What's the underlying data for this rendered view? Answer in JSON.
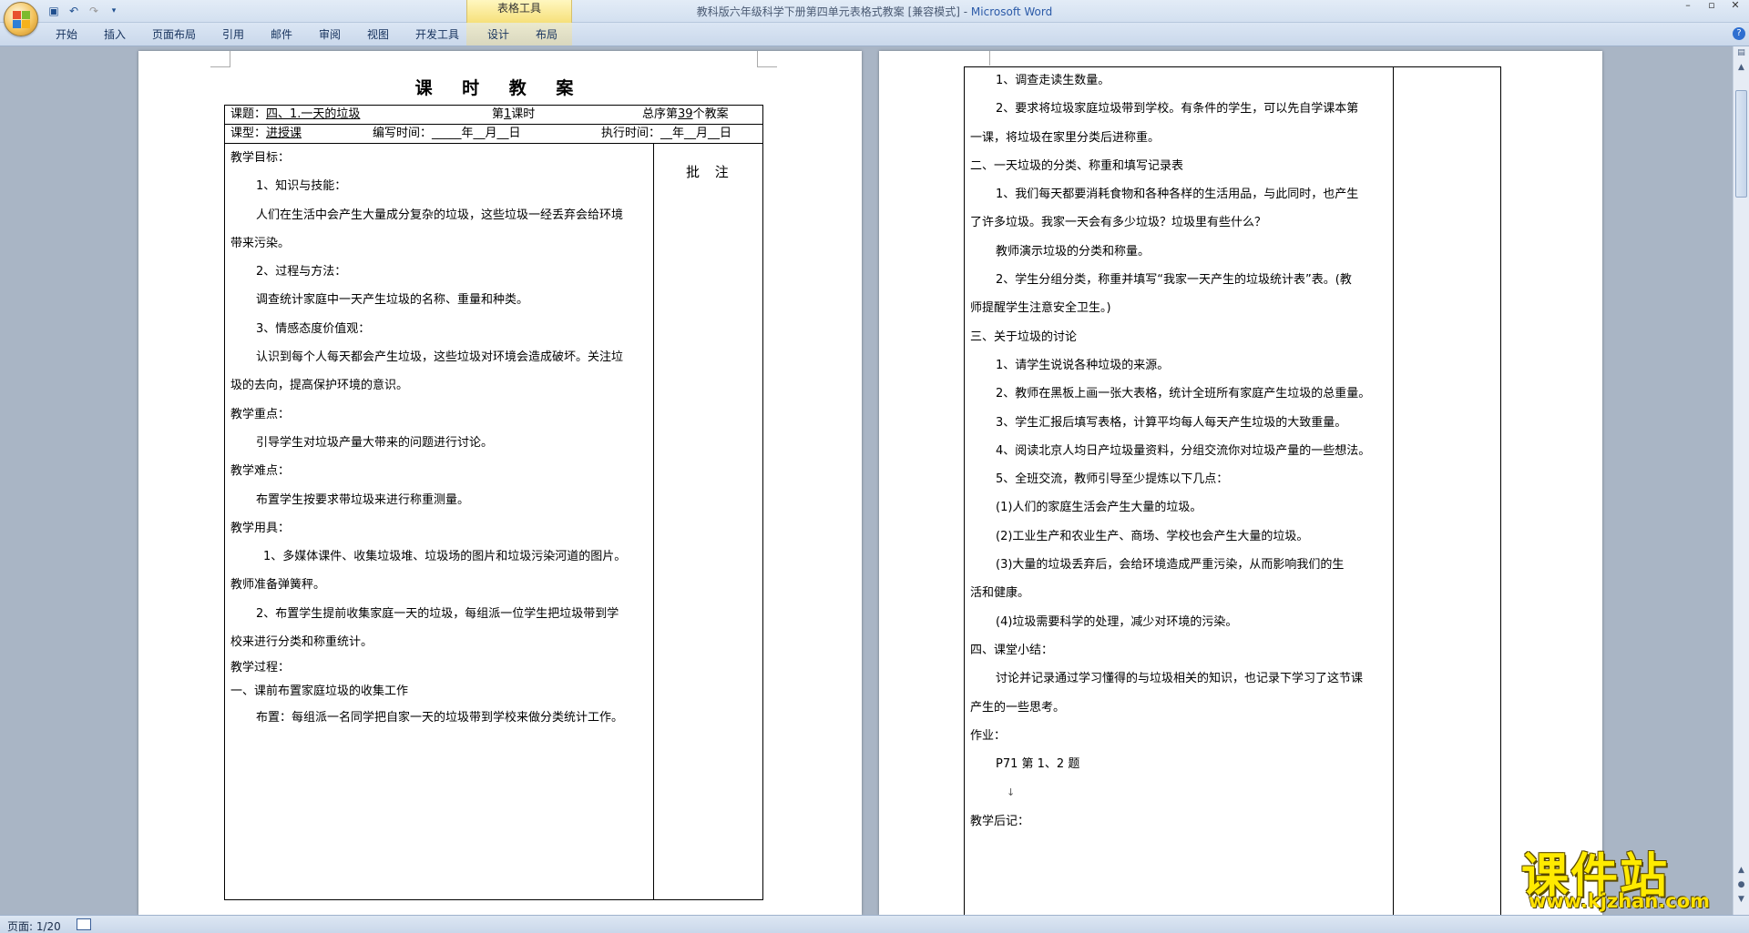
{
  "window": {
    "title": "教科版六年级科学下册第四单元表格式教案 [兼容模式] - ",
    "app_name": "Microsoft Word",
    "context_tab": "表格工具"
  },
  "ribbon_tabs": [
    "开始",
    "插入",
    "页面布局",
    "引用",
    "邮件",
    "审阅",
    "视图",
    "开发工具",
    "设计",
    "布局"
  ],
  "page1": {
    "title": "课 时 教 案",
    "header": {
      "topic_label": "课题：",
      "topic_value": "四、1.一天的垃圾",
      "lesson_prefix": "第",
      "lesson_num": "1",
      "lesson_suffix": "课时",
      "total_prefix": "总序第",
      "total_num": "39",
      "total_suffix": "个教案",
      "type_label": "课型：",
      "type_value": "进授课",
      "write_time": "编写时间：_____年__月__日",
      "exec_time": "执行时间：__年__月__日"
    },
    "annotation_label": "批 注",
    "lines": [
      "教学目标：",
      "1、知识与技能：",
      "人们在生活中会产生大量成分复杂的垃圾，这些垃圾一经丢弃会给环境",
      "带来污染。",
      "",
      "2、过程与方法：",
      "调查统计家庭中一天产生垃圾的名称、重量和种类。",
      "",
      "3、情感态度价值观：",
      "认识到每个人每天都会产生垃圾，这些垃圾对环境会造成破坏。关注垃",
      "圾的去向，提高保护环境的意识。",
      "",
      "教学重点：",
      "引导学生对垃圾产量大带来的问题进行讨论。",
      "",
      "教学难点：",
      "布置学生按要求带垃圾来进行称重测量。",
      "",
      "教学用具：",
      "1、多媒体课件、收集垃圾堆、垃圾场的图片和垃圾污染河道的图片。",
      "教师准备弹簧秤。",
      "2、布置学生提前收集家庭一天的垃圾，每组派一位学生把垃圾带到学",
      "校来进行分类和称重统计。",
      "",
      "教学过程：",
      "一、课前布置家庭垃圾的收集工作",
      "布置：每组派一名同学把自家一天的垃圾带到学校来做分类统计工作。"
    ]
  },
  "page2": {
    "lines": [
      "1、调查走读生数量。",
      "2、要求将垃圾家庭垃圾带到学校。有条件的学生，可以先自学课本第",
      "一课，将垃圾在家里分类后进称重。",
      "二、一天垃圾的分类、称重和填写记录表",
      "1、我们每天都要消耗食物和各种各样的生活用品，与此同时，也产生",
      "了许多垃圾。我家一天会有多少垃圾？垃圾里有些什么？",
      "教师演示垃圾的分类和称量。",
      "2、学生分组分类，称重并填写“我家一天产生的垃圾统计表”表。(教",
      "师提醒学生注意安全卫生。)",
      "三、关于垃圾的讨论",
      "1、请学生说说各种垃圾的来源。",
      "2、教师在黑板上画一张大表格，统计全班所有家庭产生垃圾的总重量。",
      "3、学生汇报后填写表格，计算平均每人每天产生垃圾的大致重量。",
      "4、阅读北京人均日产垃圾量资料，分组交流你对垃圾产量的一些想法。",
      "5、全班交流，教师引导至少提炼以下几点：",
      "(1)人们的家庭生活会产生大量的垃圾。",
      "(2)工业生产和农业生产、商场、学校也会产生大量的垃圾。",
      "(3)大量的垃圾丢弃后，会给环境造成严重污染，从而影响我们的生",
      "活和健康。",
      "(4)垃圾需要科学的处理，减少对环境的污染。",
      "四、课堂小结：",
      "讨论并记录通过学习懂得的与垃圾相关的知识，也记录下学习了这节课",
      "产生的一些思考。",
      "作业：",
      "P71 第 1、2 题",
      "↓",
      "教学后记：",
      "",
      ""
    ]
  },
  "status": {
    "page": "页面: 1/20"
  },
  "watermark": {
    "brand": "课件站",
    "url": "www.kjzhan.com"
  },
  "colors": {
    "background": "#a9b5c5",
    "ribbon": "#d3e0f0",
    "context_tab": "#f6e07a",
    "watermark": "#ffea00"
  }
}
